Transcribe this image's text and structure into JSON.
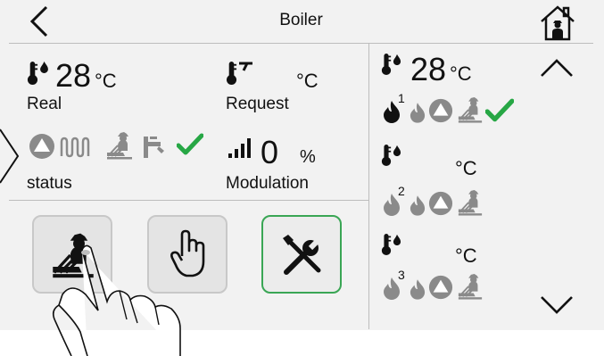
{
  "header": {
    "title": "Boiler",
    "back_icon": "chevron-left-icon",
    "home_icon": "house-with-chimney-sweep-icon"
  },
  "main": {
    "real": {
      "value": "28",
      "unit": "°C",
      "label": "Real"
    },
    "request": {
      "value": "",
      "unit": "°C",
      "label": "Request"
    },
    "status": {
      "label": "status"
    },
    "modulation": {
      "value": "0",
      "unit": "%",
      "label": "Modulation"
    }
  },
  "actions": {
    "chimney_sweep": "chimney-sweep-icon",
    "manual": "hand-pointer-icon",
    "service": "tools-icon"
  },
  "stages": [
    {
      "temp": "28",
      "unit": "°C",
      "number": "1"
    },
    {
      "temp": "",
      "unit": "°C",
      "number": "2"
    },
    {
      "temp": "",
      "unit": "°C",
      "number": "3"
    }
  ],
  "colors": {
    "accent_green": "#27a745",
    "active_border": "#3aa655",
    "background": "#f2f2f2",
    "divider": "#bdbdbd"
  }
}
